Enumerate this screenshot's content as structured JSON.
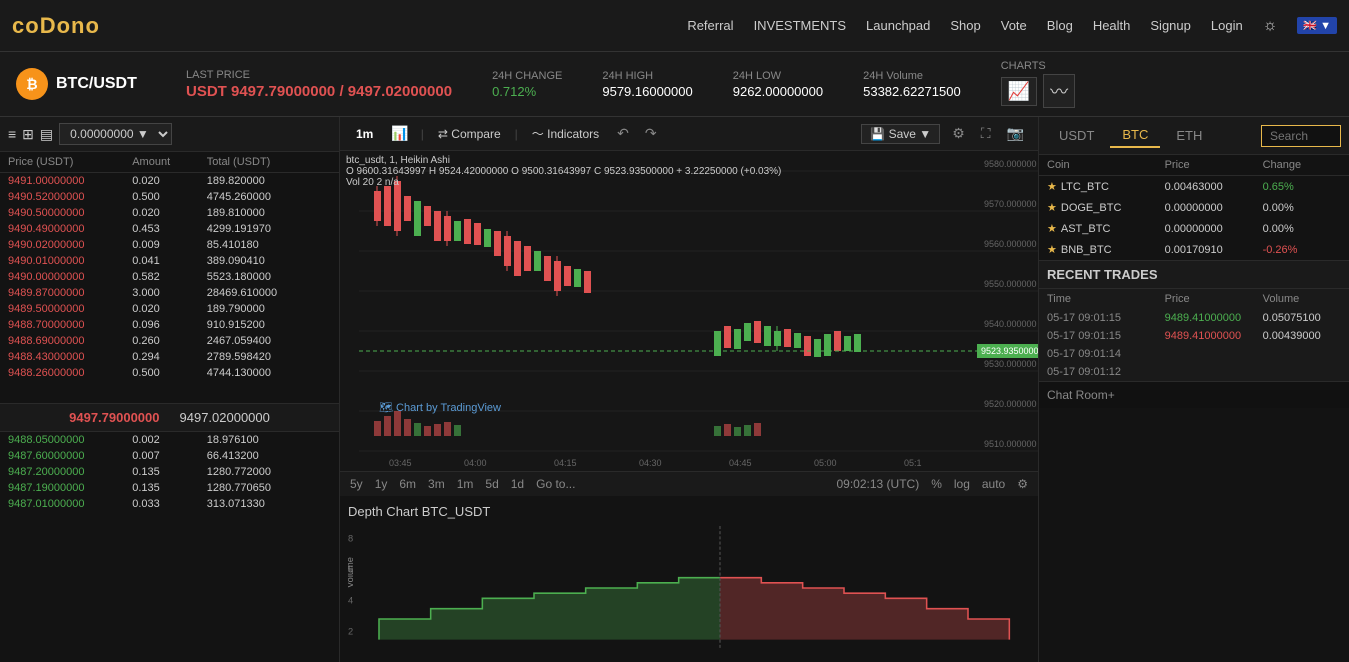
{
  "nav": {
    "logo_text": "coDono",
    "links": [
      "Referral",
      "INVESTMENTS",
      "Launchpad",
      "Shop",
      "Vote",
      "Blog",
      "Health",
      "Signup",
      "Login"
    ]
  },
  "ticker": {
    "pair": "BTC/USDT",
    "last_price_label": "LAST PRICE",
    "last_price": "USDT 9497.79000000 / 9497.02000000",
    "change_label": "24H CHANGE",
    "change_value": "0.712%",
    "high_label": "24H HIGH",
    "high_value": "9579.16000000",
    "low_label": "24H LOW",
    "low_value": "9262.00000000",
    "volume_label": "24H Volume",
    "volume_value": "53382.62271500",
    "charts_label": "CHARTS"
  },
  "order_book": {
    "cols": [
      "Price (USDT)",
      "Amount",
      "Total (USDT)"
    ],
    "dropdown_value": "0.00000000 ▼",
    "sell_orders": [
      {
        "price": "9491.00000000",
        "amount": "0.020",
        "total": "189.820000"
      },
      {
        "price": "9490.52000000",
        "amount": "0.500",
        "total": "4745.260000"
      },
      {
        "price": "9490.50000000",
        "amount": "0.020",
        "total": "189.810000"
      },
      {
        "price": "9490.49000000",
        "amount": "0.453",
        "total": "4299.191970"
      },
      {
        "price": "9490.02000000",
        "amount": "0.009",
        "total": "85.410180"
      },
      {
        "price": "9490.01000000",
        "amount": "0.041",
        "total": "389.090410"
      },
      {
        "price": "9490.00000000",
        "amount": "0.582",
        "total": "5523.180000"
      },
      {
        "price": "9489.87000000",
        "amount": "3.000",
        "total": "28469.610000"
      },
      {
        "price": "9489.50000000",
        "amount": "0.020",
        "total": "189.790000"
      },
      {
        "price": "9488.70000000",
        "amount": "0.096",
        "total": "910.915200"
      },
      {
        "price": "9488.69000000",
        "amount": "0.260",
        "total": "2467.059400"
      },
      {
        "price": "9488.43000000",
        "amount": "0.294",
        "total": "2789.598420"
      },
      {
        "price": "9488.26000000",
        "amount": "0.500",
        "total": "4744.130000"
      }
    ],
    "mid_price": "9497.79000000",
    "mid_price2": "9497.02000000",
    "buy_orders": [
      {
        "price": "9488.05000000",
        "amount": "0.002",
        "total": "18.976100"
      },
      {
        "price": "9487.60000000",
        "amount": "0.007",
        "total": "66.413200"
      },
      {
        "price": "9487.20000000",
        "amount": "0.135",
        "total": "1280.772000"
      },
      {
        "price": "9487.19000000",
        "amount": "0.135",
        "total": "1280.770650"
      },
      {
        "price": "9487.01000000",
        "amount": "0.033",
        "total": "313.071330"
      }
    ]
  },
  "chart": {
    "pair_label": "btc_usdt, 1, Heikin Ashi",
    "info": "O 9600.31643997  H 9524.42000000  O 9500.31643997  C 9523.93500000 + 3.22250000 (+0.03%)",
    "volume_label": "Vol 20  2 n/a",
    "price_marker": "9523.93500000",
    "watermark": "Chart by TradingView",
    "timeframes": [
      "5y",
      "1y",
      "6m",
      "3m",
      "1m",
      "5d",
      "1d",
      "Go to..."
    ],
    "current_tf": "1m",
    "time_display": "09:02:13 (UTC)",
    "depth_title": "Depth Chart BTC_USDT"
  },
  "coin_panel": {
    "tabs": [
      "USDT",
      "BTC",
      "ETH"
    ],
    "active_tab": "BTC",
    "search_placeholder": "Search",
    "cols": [
      "Coin",
      "Price",
      "Change"
    ],
    "coins": [
      {
        "name": "LTC_BTC",
        "price": "0.00463000",
        "change": "0.65%",
        "change_type": "positive"
      },
      {
        "name": "DOGE_BTC",
        "price": "0.00000000",
        "change": "0.00%",
        "change_type": "neutral"
      },
      {
        "name": "AST_BTC",
        "price": "0.00000000",
        "change": "0.00%",
        "change_type": "neutral"
      },
      {
        "name": "BNB_BTC",
        "price": "0.00170910",
        "change": "-0.26%",
        "change_type": "negative"
      }
    ]
  },
  "recent_trades": {
    "title": "RECENT TRADES",
    "cols": [
      "Time",
      "Price",
      "Volume"
    ],
    "trades": [
      {
        "time": "05-17 09:01:15",
        "price": "9489.41000000",
        "volume": "0.05075100",
        "type": "green"
      },
      {
        "time": "05-17 09:01:15",
        "price": "9489.41000000",
        "volume": "0.00439000",
        "type": "red"
      },
      {
        "time": "05-17 09:01:14",
        "price": "",
        "volume": "",
        "type": "green"
      },
      {
        "time": "05-17 09:01:12",
        "price": "",
        "volume": "",
        "type": "green"
      }
    ],
    "chat_label": "Chat Room+"
  }
}
